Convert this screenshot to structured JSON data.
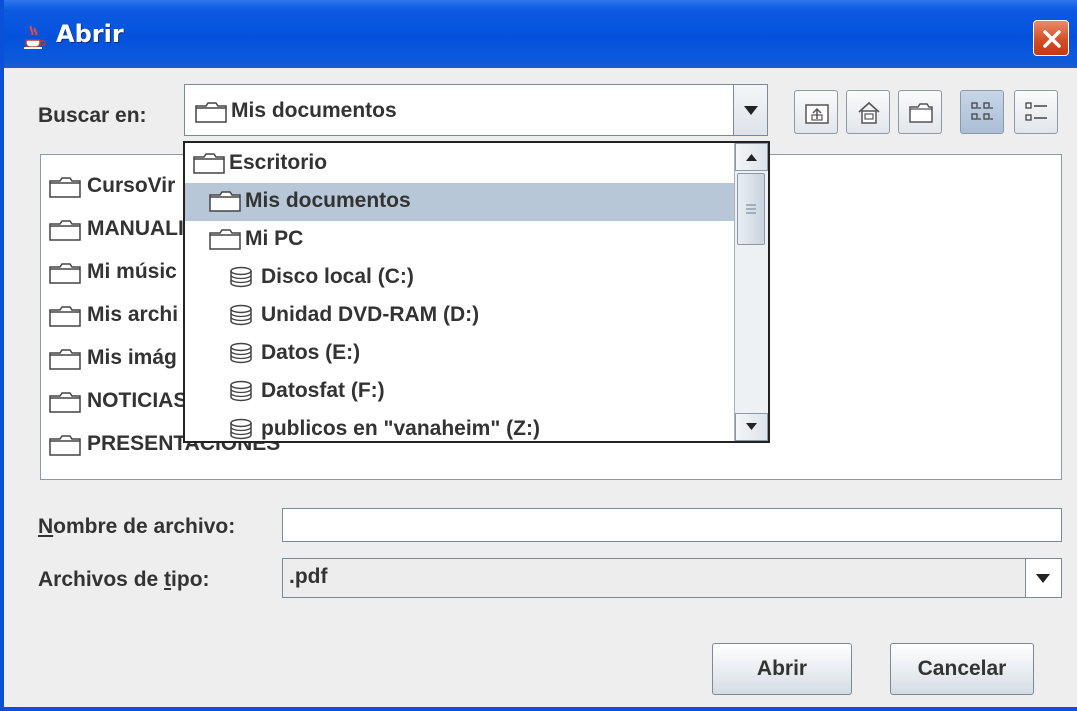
{
  "window": {
    "title": "Abrir",
    "icon": "java-cup-icon",
    "close_icon": "close-x-icon"
  },
  "look_in": {
    "label": "Buscar en:",
    "selected": "Mis documentos"
  },
  "toolbar": {
    "buttons": [
      {
        "icon": "up-folder-icon"
      },
      {
        "icon": "home-icon"
      },
      {
        "icon": "new-folder-icon"
      },
      {
        "icon": "list-view-icon",
        "active": true
      },
      {
        "icon": "details-view-icon"
      }
    ]
  },
  "dropdown": {
    "items": [
      {
        "label": "Escritorio",
        "icon": "folder-icon"
      },
      {
        "label": "Mis documentos",
        "icon": "folder-icon",
        "selected": true
      },
      {
        "label": "Mi PC",
        "icon": "folder-icon"
      },
      {
        "label": "Disco local (C:)",
        "icon": "drive-icon"
      },
      {
        "label": "Unidad DVD-RAM (D:)",
        "icon": "drive-icon"
      },
      {
        "label": "Datos (E:)",
        "icon": "drive-icon"
      },
      {
        "label": "Datosfat (F:)",
        "icon": "drive-icon"
      },
      {
        "label": "publicos en \"vanaheim\" (Z:)",
        "icon": "drive-icon"
      }
    ]
  },
  "files": [
    {
      "label": "CursoVir",
      "icon": "folder-icon"
    },
    {
      "label": "MANUALI",
      "icon": "folder-icon"
    },
    {
      "label": "Mi músic",
      "icon": "folder-icon"
    },
    {
      "label": "Mis archi",
      "icon": "folder-icon"
    },
    {
      "label": "Mis imág",
      "icon": "folder-icon"
    },
    {
      "label": "NOTICIAS",
      "icon": "folder-icon"
    },
    {
      "label": "PRESENTACIONES",
      "icon": "folder-icon"
    }
  ],
  "file_name": {
    "label_mnemonic": "N",
    "label_rest": "ombre de archivo:",
    "value": ""
  },
  "file_type": {
    "label_before": "Archivos de ",
    "label_mnemonic": "t",
    "label_after": "ipo:",
    "value": ".pdf"
  },
  "buttons": {
    "open": "Abrir",
    "cancel": "Cancelar"
  }
}
